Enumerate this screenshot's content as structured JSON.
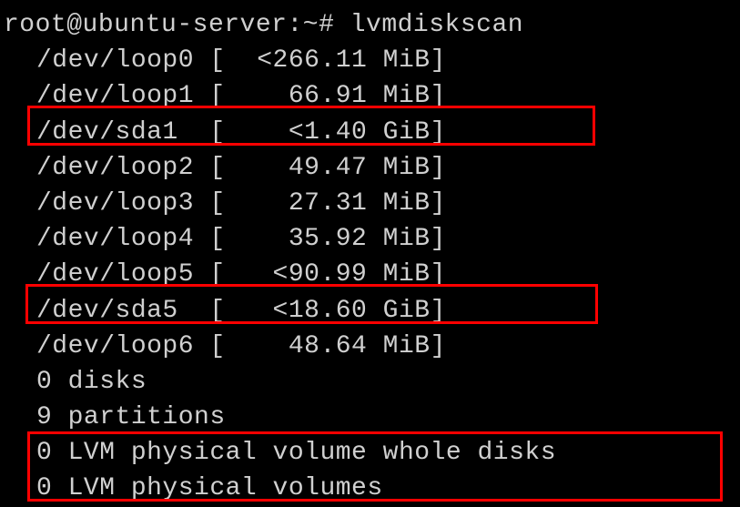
{
  "prompt": {
    "user": "root",
    "host": "ubuntu-server",
    "path": "~",
    "symbol": "#",
    "command": "lvmdiskscan"
  },
  "rows": [
    {
      "device": "/dev/loop0",
      "size": "<266.11 MiB"
    },
    {
      "device": "/dev/loop1",
      "size": "66.91 MiB"
    },
    {
      "device": "/dev/sda1 ",
      "size": "<1.40 GiB"
    },
    {
      "device": "/dev/loop2",
      "size": "49.47 MiB"
    },
    {
      "device": "/dev/loop3",
      "size": "27.31 MiB"
    },
    {
      "device": "/dev/loop4",
      "size": "35.92 MiB"
    },
    {
      "device": "/dev/loop5",
      "size": "<90.99 MiB"
    },
    {
      "device": "/dev/sda5 ",
      "size": "<18.60 GiB"
    },
    {
      "device": "/dev/loop6",
      "size": "48.64 MiB"
    }
  ],
  "summary": {
    "disks": "0 disks",
    "partitions": "9 partitions",
    "pv_whole": "0 LVM physical volume whole disks",
    "pv": "0 LVM physical volumes"
  }
}
